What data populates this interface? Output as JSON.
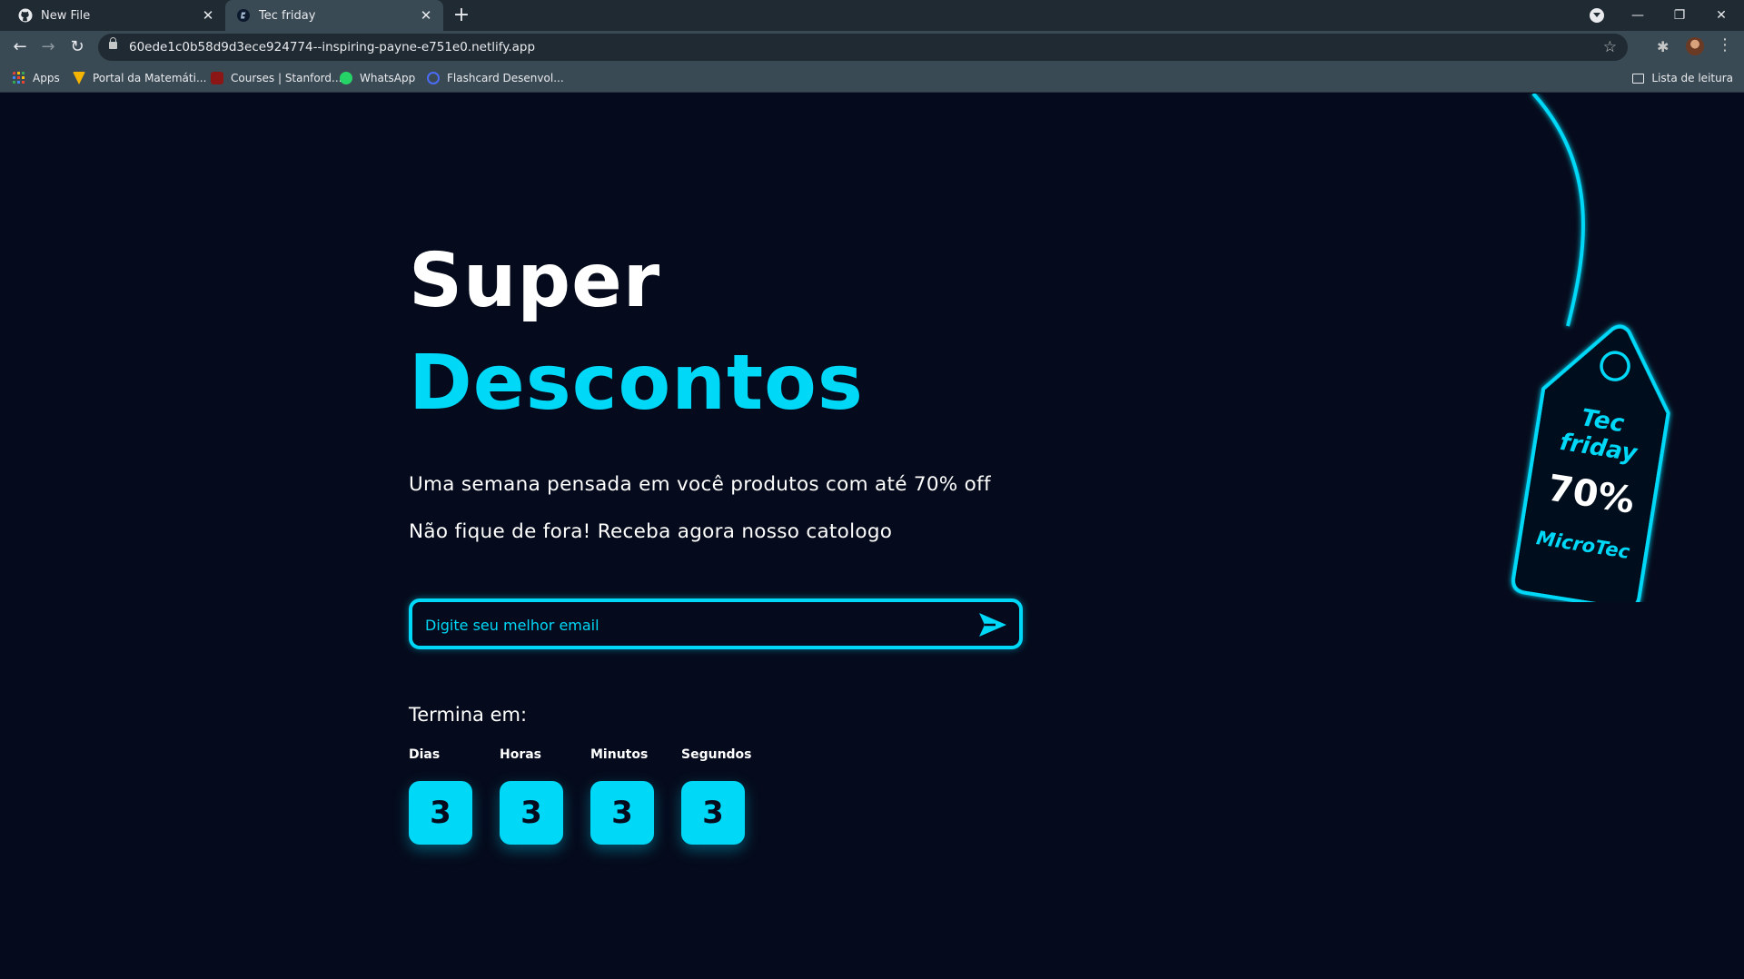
{
  "browser": {
    "tabs": [
      {
        "title": "New File",
        "icon": "github-icon"
      },
      {
        "title": "Tec friday",
        "icon": "site-icon",
        "active": true
      }
    ],
    "url": "60ede1c0b58d9d3ece924774--inspiring-payne-e751e0.netlify.app",
    "bookmarks": [
      {
        "label": "Apps",
        "icon": "apps-grid-icon"
      },
      {
        "label": "Portal da Matemáti...",
        "icon": "portal-icon"
      },
      {
        "label": "Courses | Stanford...",
        "icon": "stanford-icon"
      },
      {
        "label": "WhatsApp",
        "icon": "whatsapp-icon"
      },
      {
        "label": "Flashcard Desenvol...",
        "icon": "flashcard-icon"
      }
    ],
    "reading_list": "Lista de leitura"
  },
  "hero": {
    "title_line1": "Super",
    "title_line2": "Descontos",
    "subtitle1": "Uma semana pensada em você produtos com até 70% off",
    "subtitle2": "Não fique de fora! Receba agora nosso catologo"
  },
  "email_form": {
    "placeholder": "Digite seu melhor email",
    "value": ""
  },
  "countdown": {
    "label": "Termina em:",
    "units": [
      {
        "label": "Dias",
        "value": "3"
      },
      {
        "label": "Horas",
        "value": "3"
      },
      {
        "label": "Minutos",
        "value": "3"
      },
      {
        "label": "Segundos",
        "value": "3"
      }
    ]
  },
  "tag": {
    "line1": "Tec",
    "line2": "friday",
    "discount": "70%",
    "brand": "MicroTec"
  },
  "colors": {
    "background": "#050b1c",
    "accent": "#00d8f8",
    "text": "#ffffff"
  }
}
